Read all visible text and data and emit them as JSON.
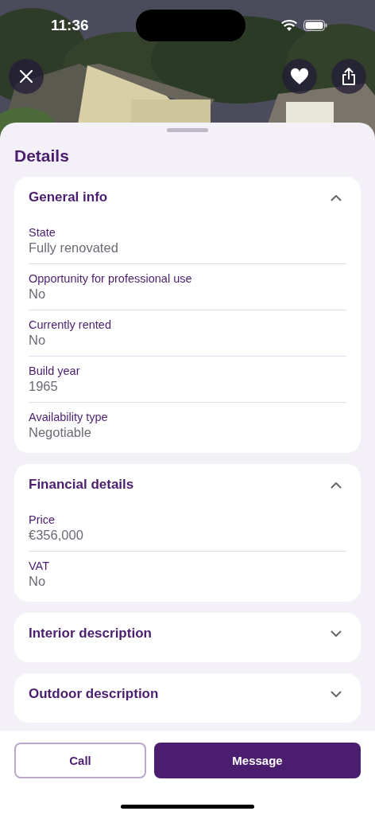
{
  "status_bar": {
    "time": "11:36"
  },
  "sheet": {
    "title": "Details"
  },
  "sections": [
    {
      "title": "General info",
      "expanded": true,
      "items": [
        {
          "label": "State",
          "value": "Fully renovated"
        },
        {
          "label": "Opportunity for professional use",
          "value": "No"
        },
        {
          "label": "Currently rented",
          "value": "No"
        },
        {
          "label": "Build year",
          "value": "1965"
        },
        {
          "label": "Availability type",
          "value": "Negotiable"
        }
      ]
    },
    {
      "title": "Financial details",
      "expanded": true,
      "items": [
        {
          "label": "Price",
          "value": "€356,000"
        },
        {
          "label": "VAT",
          "value": "No"
        }
      ]
    },
    {
      "title": "Interior description",
      "expanded": false
    },
    {
      "title": "Outdoor description",
      "expanded": false
    }
  ],
  "actions": [
    {
      "label": "Call",
      "kind": "secondary"
    },
    {
      "label": "Message",
      "kind": "primary"
    }
  ]
}
